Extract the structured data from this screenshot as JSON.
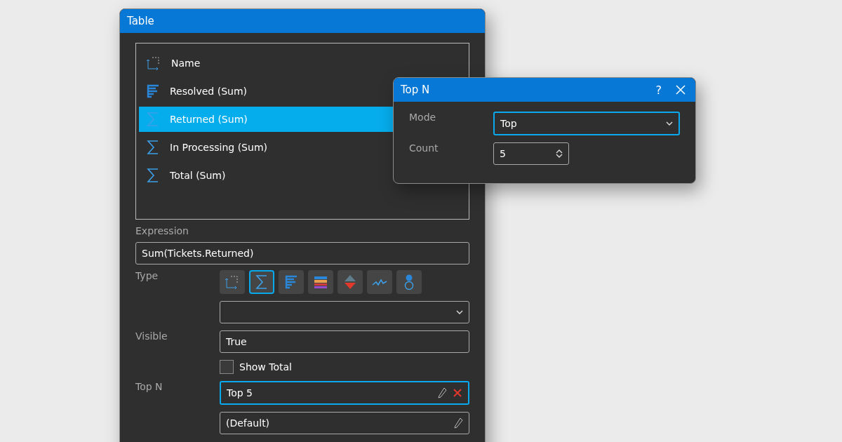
{
  "table_window": {
    "title": "Table",
    "fields": [
      {
        "label": "Name",
        "kind": "dimension",
        "selected": false
      },
      {
        "label": "Resolved (Sum)",
        "kind": "bars",
        "selected": false
      },
      {
        "label": "Returned (Sum)",
        "kind": "sum",
        "selected": true
      },
      {
        "label": "In Processing (Sum)",
        "kind": "sum",
        "selected": false
      },
      {
        "label": "Total (Sum)",
        "kind": "sum",
        "selected": false
      }
    ],
    "expression": {
      "label": "Expression",
      "value": "Sum(Tickets.Returned)"
    },
    "type": {
      "label": "Type",
      "options": [
        {
          "kind": "dimension",
          "selected": false
        },
        {
          "kind": "sum",
          "selected": true
        },
        {
          "kind": "bars",
          "selected": false
        },
        {
          "kind": "stacked",
          "selected": false
        },
        {
          "kind": "delta",
          "selected": false
        },
        {
          "kind": "sparkline",
          "selected": false
        },
        {
          "kind": "bubble",
          "selected": false
        }
      ]
    },
    "visible": {
      "label": "Visible",
      "value": "True"
    },
    "show_total": {
      "label": "Show Total",
      "checked": false
    },
    "top_n": {
      "label": "Top N",
      "value": "Top 5",
      "focused": true
    },
    "format": {
      "value": "(Default)"
    }
  },
  "top_n_dialog": {
    "title": "Top N",
    "help": "?",
    "mode": {
      "label": "Mode",
      "value": "Top"
    },
    "count": {
      "label": "Count",
      "value": "5"
    }
  }
}
